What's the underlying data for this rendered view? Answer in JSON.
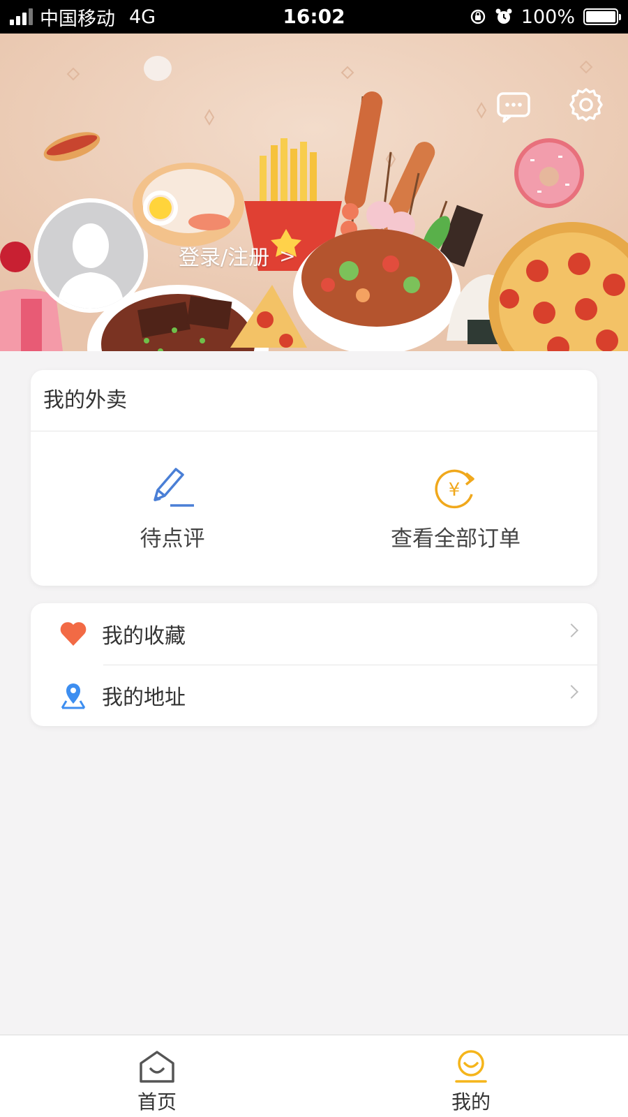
{
  "status_bar": {
    "carrier": "中国移动",
    "network": "4G",
    "time": "16:02",
    "battery": "100%",
    "battery_level": 1.0
  },
  "header": {
    "login_label": "登录/注册",
    "login_chevron": ">",
    "icons": [
      "message-icon",
      "settings-icon"
    ]
  },
  "orders_card": {
    "title": "我的外卖",
    "actions": [
      {
        "label": "待点评",
        "icon": "pencil-review-icon",
        "color": "#4a7fd6"
      },
      {
        "label": "查看全部订单",
        "icon": "yuan-refresh-icon",
        "color": "#f0a81c"
      }
    ]
  },
  "menu": {
    "items": [
      {
        "label": "我的收藏",
        "icon": "heart-icon",
        "color": "#f26a45"
      },
      {
        "label": "我的地址",
        "icon": "location-pin-icon",
        "color": "#3d8ef0"
      }
    ]
  },
  "tab_bar": {
    "tabs": [
      {
        "label": "首页",
        "icon": "home-icon",
        "active": false
      },
      {
        "label": "我的",
        "icon": "profile-icon",
        "active": true,
        "color": "#f5b51b"
      }
    ]
  }
}
